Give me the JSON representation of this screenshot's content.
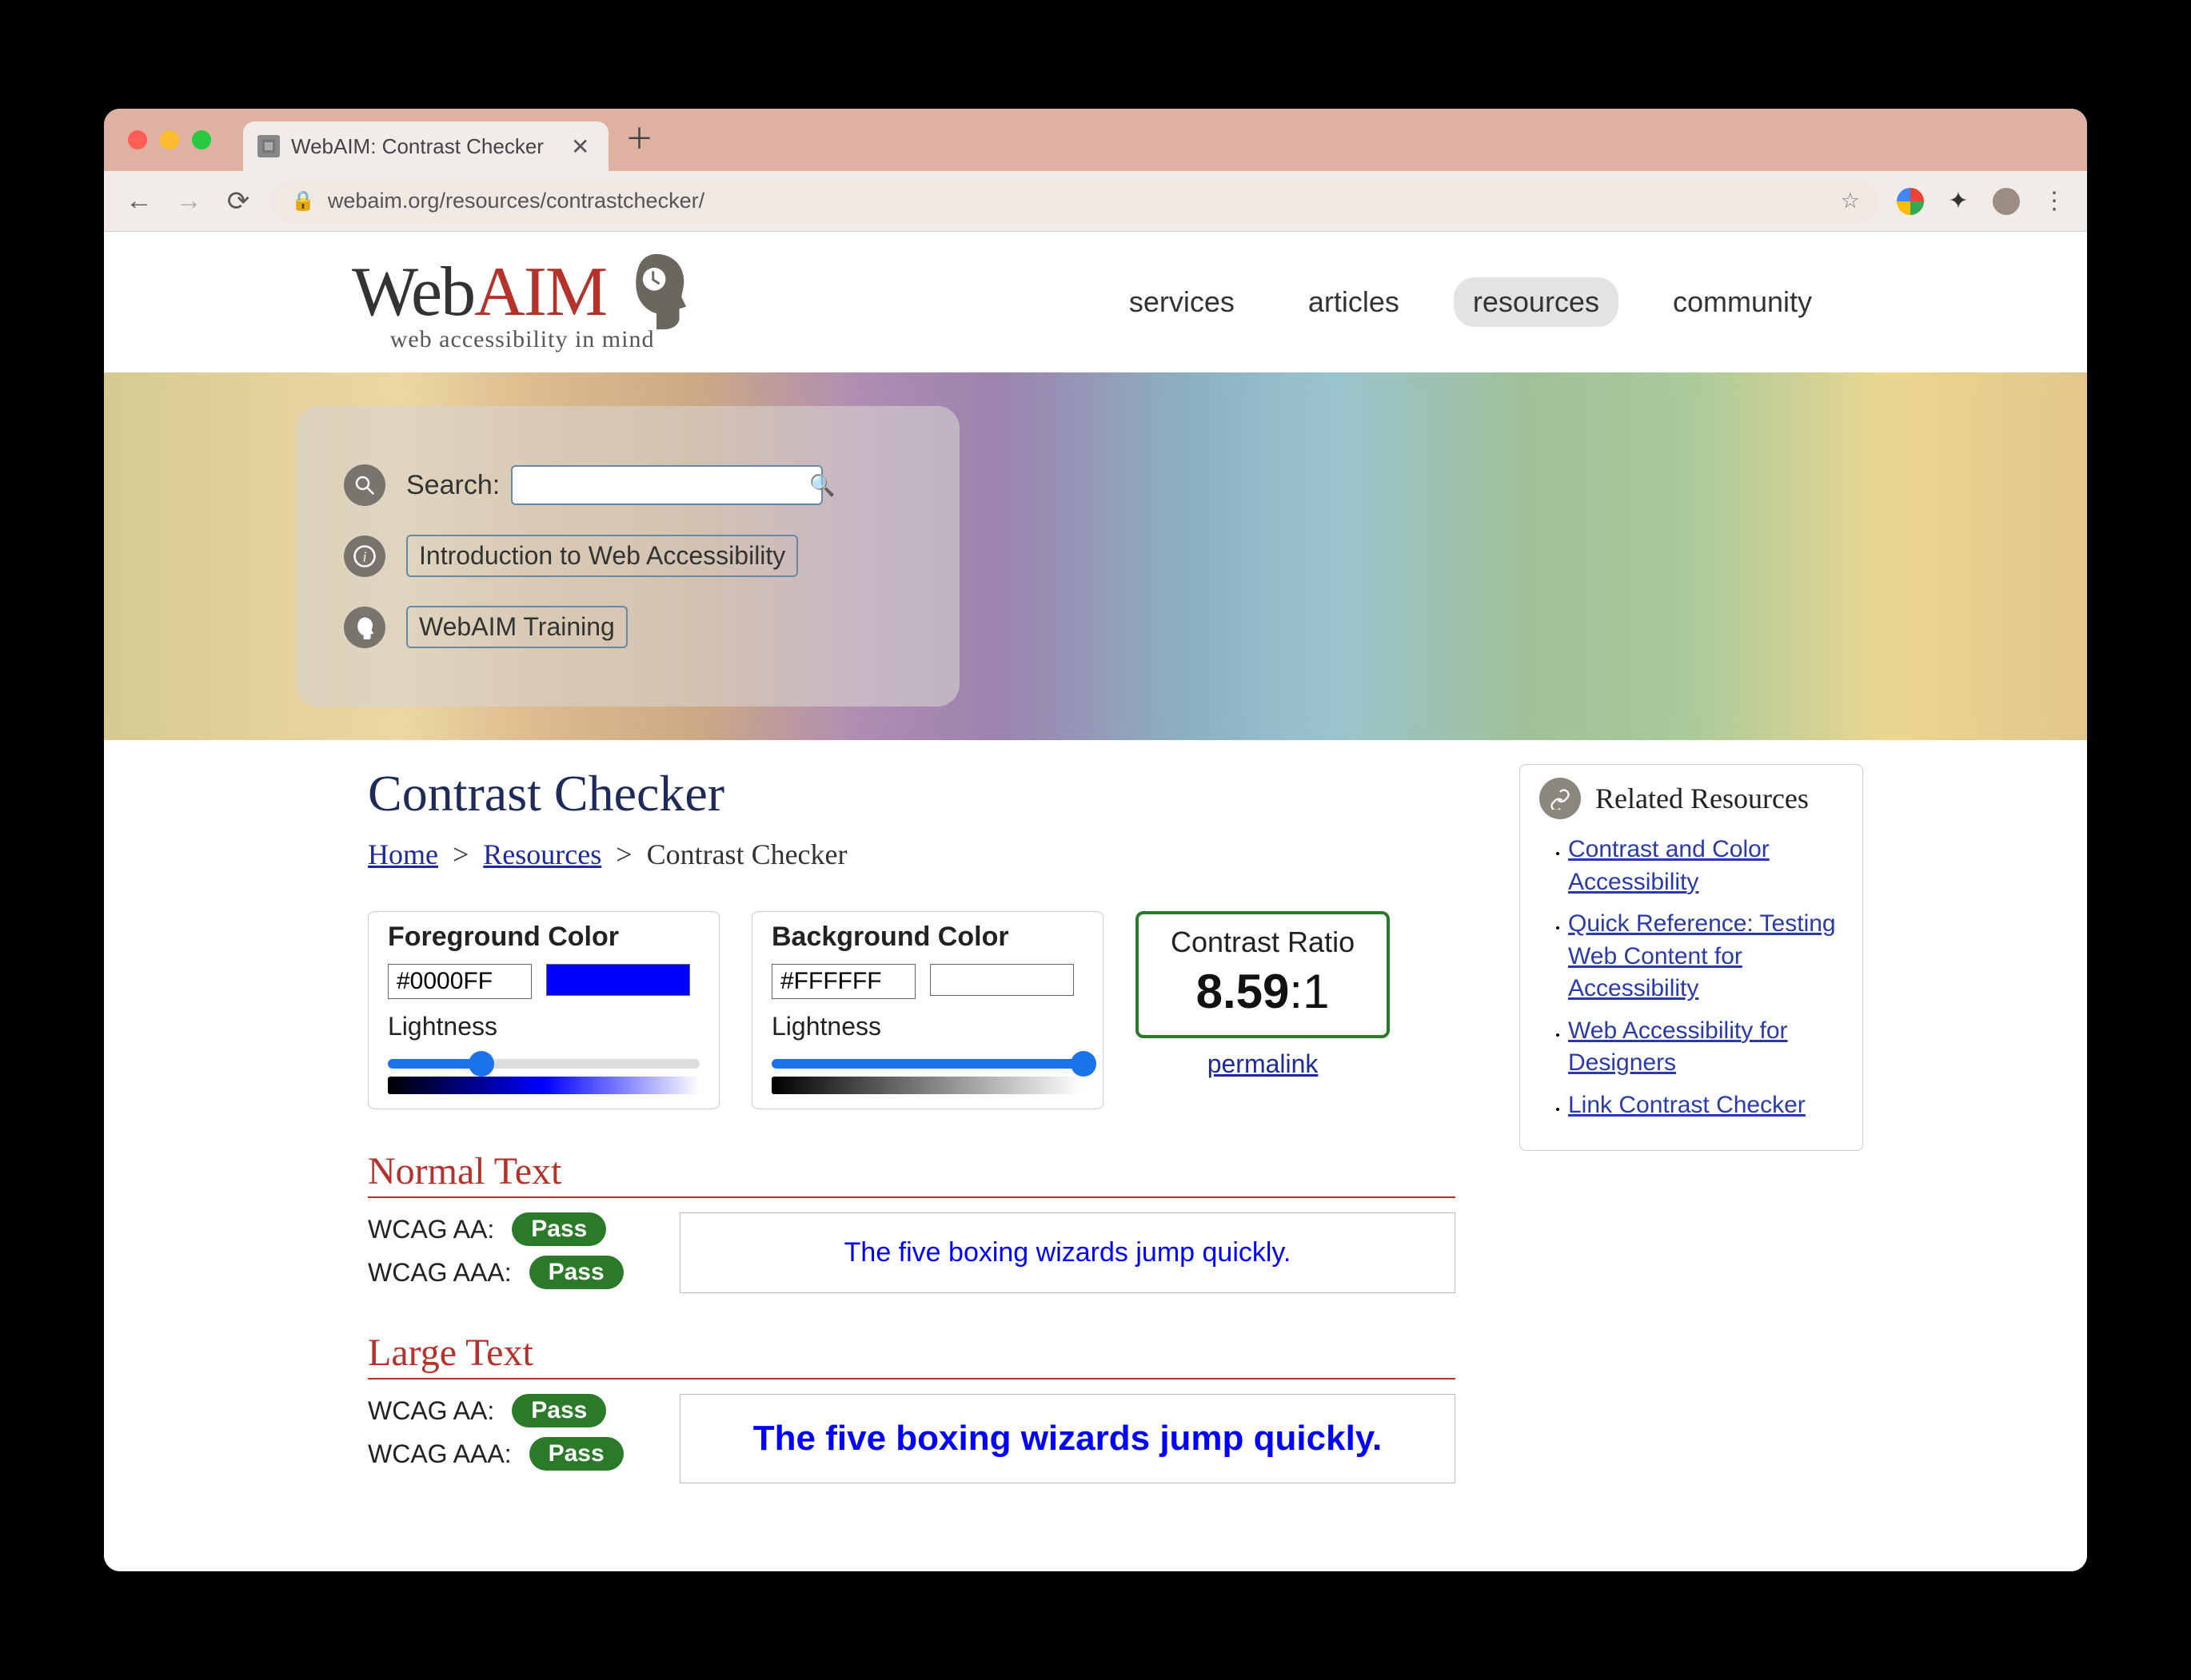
{
  "browser": {
    "tab_title": "WebAIM: Contrast Checker",
    "url": "webaim.org/resources/contrastchecker/"
  },
  "logo": {
    "word1": "Web",
    "word2": "AIM",
    "tagline": "web accessibility in mind"
  },
  "nav": {
    "services": "services",
    "articles": "articles",
    "resources": "resources",
    "community": "community"
  },
  "hero": {
    "search_label": "Search:",
    "intro_link": "Introduction to Web Accessibility",
    "training_link": "WebAIM Training"
  },
  "page": {
    "title": "Contrast Checker",
    "breadcrumb": {
      "home": "Home",
      "resources": "Resources",
      "current": "Contrast Checker"
    }
  },
  "foreground": {
    "heading": "Foreground Color",
    "value": "#0000FF",
    "swatch": "#0000FF",
    "lightness_label": "Lightness",
    "lightness_pct": 30,
    "gradient_css": "linear-gradient(90deg,#000 0%, #0000ff 50%, #fff 100%)"
  },
  "background": {
    "heading": "Background Color",
    "value": "#FFFFFF",
    "swatch": "#FFFFFF",
    "lightness_label": "Lightness",
    "lightness_pct": 100,
    "gradient_css": "linear-gradient(90deg,#000 0%, #fff 100%)"
  },
  "ratio": {
    "label": "Contrast Ratio",
    "value": "8.59",
    "suffix": ":1",
    "permalink": "permalink"
  },
  "normal": {
    "heading": "Normal Text",
    "aa_label": "WCAG AA:",
    "aa_result": "Pass",
    "aaa_label": "WCAG AAA:",
    "aaa_result": "Pass",
    "sample": "The five boxing wizards jump quickly."
  },
  "large": {
    "heading": "Large Text",
    "aa_label": "WCAG AA:",
    "aa_result": "Pass",
    "aaa_label": "WCAG AAA:",
    "aaa_result": "Pass",
    "sample": "The five boxing wizards jump quickly."
  },
  "related": {
    "heading": "Related Resources",
    "links": {
      "0": "Contrast and Color Accessibility",
      "1": "Quick Reference: Testing Web Content for Accessibility",
      "2": "Web Accessibility for Designers",
      "3": "Link Contrast Checker"
    }
  }
}
